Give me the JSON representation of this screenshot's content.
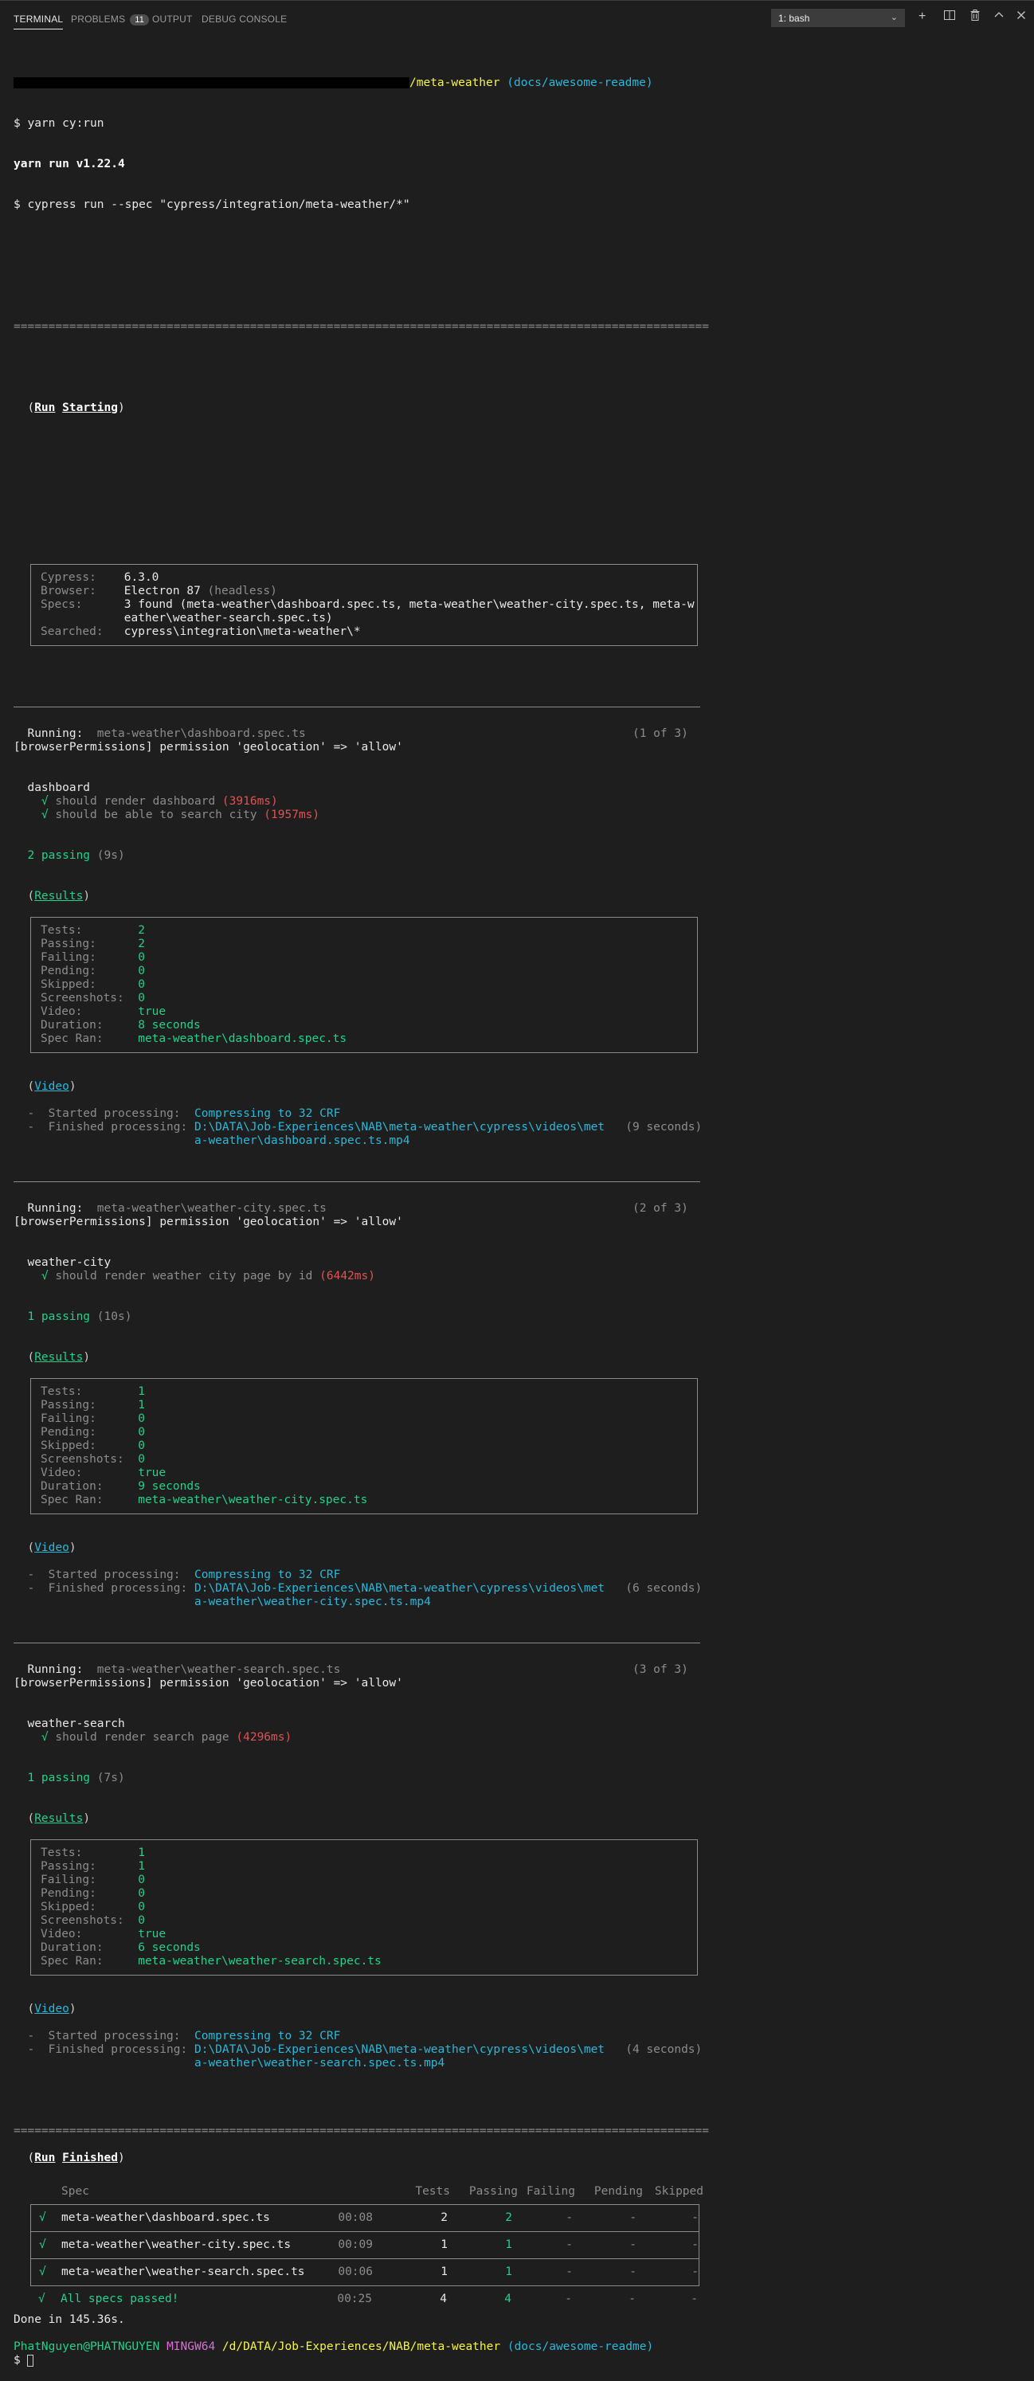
{
  "tabs": [
    {
      "label": "TERMINAL",
      "active": true
    },
    {
      "label": "PROBLEMS",
      "badge": "11"
    },
    {
      "label": "OUTPUT"
    },
    {
      "label": "DEBUG CONSOLE"
    }
  ],
  "terminal_select": "1: bash",
  "toolbar_icons": [
    "plus-icon",
    "split-icon",
    "trash-icon",
    "chevron-up-icon",
    "close-icon"
  ],
  "header": {
    "path": "/meta-weather",
    "branch": "(docs/awesome-readme)",
    "cmd1": "$ yarn cy:run",
    "yarn": "yarn run v1.22.4",
    "cmd2": "$ cypress run --spec \"cypress/integration/meta-weather/*\""
  },
  "rule": "====================================================================================================",
  "run_starting": {
    "open": "(",
    "word1": "Run",
    "word2": "Starting",
    "close": ")",
    "rows": [
      {
        "k": "Cypress:",
        "v": "6.3.0"
      },
      {
        "k": "Browser:",
        "v": "Electron 87",
        "extra": "(headless)"
      },
      {
        "k": "Specs:",
        "v": "3 found (meta-weather\\dashboard.spec.ts, meta-weather\\weather-city.spec.ts, meta-w"
      },
      {
        "k": "",
        "v": "eather\\weather-search.spec.ts)"
      },
      {
        "k": "Searched:",
        "v": "cypress\\integration\\meta-weather\\*"
      }
    ]
  },
  "specs": [
    {
      "running_label": "Running:",
      "file": "meta-weather\\dashboard.spec.ts",
      "count": "(1 of 3)",
      "perm": "[browserPermissions] permission 'geolocation' => 'allow'",
      "suite": "dashboard",
      "tests": [
        {
          "name": "should render dashboard",
          "time": "(3916ms)"
        },
        {
          "name": "should be able to search city",
          "time": "(1957ms)"
        }
      ],
      "passing": "2 passing",
      "passing_time": "(9s)",
      "results_label": "Results",
      "results": [
        {
          "k": "Tests:",
          "v": "2"
        },
        {
          "k": "Passing:",
          "v": "2"
        },
        {
          "k": "Failing:",
          "v": "0"
        },
        {
          "k": "Pending:",
          "v": "0"
        },
        {
          "k": "Skipped:",
          "v": "0"
        },
        {
          "k": "Screenshots:",
          "v": "0"
        },
        {
          "k": "Video:",
          "v": "true"
        },
        {
          "k": "Duration:",
          "v": "8 seconds"
        },
        {
          "k": "Spec Ran:",
          "v": "meta-weather\\dashboard.spec.ts"
        }
      ],
      "video_label": "Video",
      "started": "-  Started processing:",
      "compress": "Compressing to 32 CRF",
      "finished": "-  Finished processing:",
      "path1": "D:\\DATA\\Job-Experiences\\NAB\\meta-weather\\cypress\\videos\\met",
      "path2": "a-weather\\dashboard.spec.ts.mp4",
      "duration": "(9 seconds)"
    },
    {
      "running_label": "Running:",
      "file": "meta-weather\\weather-city.spec.ts",
      "count": "(2 of 3)",
      "perm": "[browserPermissions] permission 'geolocation' => 'allow'",
      "suite": "weather-city",
      "tests": [
        {
          "name": "should render weather city page by id",
          "time": "(6442ms)"
        }
      ],
      "passing": "1 passing",
      "passing_time": "(10s)",
      "results_label": "Results",
      "results": [
        {
          "k": "Tests:",
          "v": "1"
        },
        {
          "k": "Passing:",
          "v": "1"
        },
        {
          "k": "Failing:",
          "v": "0"
        },
        {
          "k": "Pending:",
          "v": "0"
        },
        {
          "k": "Skipped:",
          "v": "0"
        },
        {
          "k": "Screenshots:",
          "v": "0"
        },
        {
          "k": "Video:",
          "v": "true"
        },
        {
          "k": "Duration:",
          "v": "9 seconds"
        },
        {
          "k": "Spec Ran:",
          "v": "meta-weather\\weather-city.spec.ts"
        }
      ],
      "video_label": "Video",
      "started": "-  Started processing:",
      "compress": "Compressing to 32 CRF",
      "finished": "-  Finished processing:",
      "path1": "D:\\DATA\\Job-Experiences\\NAB\\meta-weather\\cypress\\videos\\met",
      "path2": "a-weather\\weather-city.spec.ts.mp4",
      "duration": "(6 seconds)"
    },
    {
      "running_label": "Running:",
      "file": "meta-weather\\weather-search.spec.ts",
      "count": "(3 of 3)",
      "perm": "[browserPermissions] permission 'geolocation' => 'allow'",
      "suite": "weather-search",
      "tests": [
        {
          "name": "should render search page",
          "time": "(4296ms)"
        }
      ],
      "passing": "1 passing",
      "passing_time": "(7s)",
      "results_label": "Results",
      "results": [
        {
          "k": "Tests:",
          "v": "1"
        },
        {
          "k": "Passing:",
          "v": "1"
        },
        {
          "k": "Failing:",
          "v": "0"
        },
        {
          "k": "Pending:",
          "v": "0"
        },
        {
          "k": "Skipped:",
          "v": "0"
        },
        {
          "k": "Screenshots:",
          "v": "0"
        },
        {
          "k": "Video:",
          "v": "true"
        },
        {
          "k": "Duration:",
          "v": "6 seconds"
        },
        {
          "k": "Spec Ran:",
          "v": "meta-weather\\weather-search.spec.ts"
        }
      ],
      "video_label": "Video",
      "started": "-  Started processing:",
      "compress": "Compressing to 32 CRF",
      "finished": "-  Finished processing:",
      "path1": "D:\\DATA\\Job-Experiences\\NAB\\meta-weather\\cypress\\videos\\met",
      "path2": "a-weather\\weather-search.spec.ts.mp4",
      "duration": "(4 seconds)"
    }
  ],
  "run_finished": {
    "open": "(",
    "word1": "Run",
    "word2": "Finished",
    "close": ")",
    "columns": [
      "Spec",
      "Tests",
      "Passing",
      "Failing",
      "Pending",
      "Skipped"
    ],
    "rows": [
      {
        "check": "√",
        "spec": "meta-weather\\dashboard.spec.ts",
        "time": "00:08",
        "tests": "2",
        "passing": "2",
        "failing": "-",
        "pending": "-",
        "skipped": "-"
      },
      {
        "check": "√",
        "spec": "meta-weather\\weather-city.spec.ts",
        "time": "00:09",
        "tests": "1",
        "passing": "1",
        "failing": "-",
        "pending": "-",
        "skipped": "-"
      },
      {
        "check": "√",
        "spec": "meta-weather\\weather-search.spec.ts",
        "time": "00:06",
        "tests": "1",
        "passing": "1",
        "failing": "-",
        "pending": "-",
        "skipped": "-"
      }
    ],
    "summary": {
      "check": "√",
      "label": "All specs passed!",
      "time": "00:25",
      "tests": "4",
      "passing": "4",
      "failing": "-",
      "pending": "-",
      "skipped": "-"
    }
  },
  "done": "Done in 145.36s.",
  "prompt": {
    "user": "PhatNguyen@PHATNGUYEN",
    "shell": "MINGW64",
    "path": "/d/DATA/Job-Experiences/NAB/meta-weather",
    "branch": "(docs/awesome-readme)",
    "symbol": "$"
  },
  "check": "√",
  "colors": {
    "background": "#1e1e1e",
    "green": "#23d18b",
    "red": "#e05252",
    "yellow": "#f5f543",
    "cyan": "#29b8db",
    "blue": "#3b8eea",
    "magenta": "#d670d6"
  }
}
